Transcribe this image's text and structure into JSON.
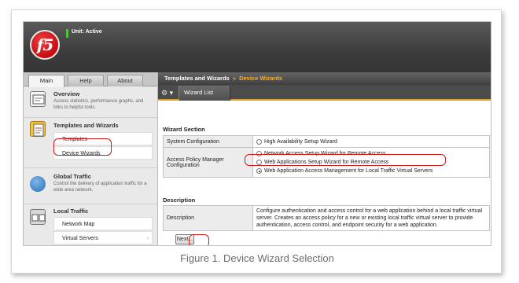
{
  "banner": {
    "logo_text": "f5",
    "status_text": "Unit: Active",
    "status_color": "#49c93a",
    "brand_color": "#c40d12"
  },
  "left_tabs": [
    "Main",
    "Help",
    "About"
  ],
  "sidebar": {
    "overview": {
      "title": "Overview",
      "desc": "Access statistics, performance graphs, and links to helpful tools."
    },
    "templates": {
      "title": "Templates and Wizards",
      "items": [
        "Templates",
        "Device Wizards"
      ]
    },
    "global": {
      "title": "Global Traffic",
      "desc": "Control the delivery of application traffic for a wide area network."
    },
    "local": {
      "title": "Local Traffic",
      "items": [
        "Network Map",
        "Virtual Servers"
      ]
    }
  },
  "main": {
    "breadcrumb_parent": "Templates and Wizards",
    "breadcrumb_sep": "»",
    "breadcrumb_current": "Device Wizards",
    "toolbar_tab": "Wizard List",
    "wizard_section": {
      "heading": "Wizard Section",
      "rows": [
        {
          "label": "System Configuration",
          "options": [
            {
              "text": "High Availability Setup Wizard",
              "selected": false
            }
          ]
        },
        {
          "label": "Access Policy Manager Configuration",
          "options": [
            {
              "text": "Network Access Setup Wizard for Remote Access",
              "selected": false
            },
            {
              "text": "Web Applications Setup Wizard for Remote Access",
              "selected": false
            },
            {
              "text": "Web Application Access Management for Local Traffic Virtual Servers",
              "selected": true
            }
          ]
        }
      ]
    },
    "description_section": {
      "heading": "Description",
      "label": "Description",
      "text": "Configure authentication and access control for a web application behind a local traffic virtual server. Creates an access policy for a new or existing local traffic virtual server to provide authentication, access control, and endpoint security for a web application."
    },
    "next_label": "Next..."
  },
  "caption": "Figure 1. Device Wizard Selection",
  "highlight_color": "#cc1a1a"
}
